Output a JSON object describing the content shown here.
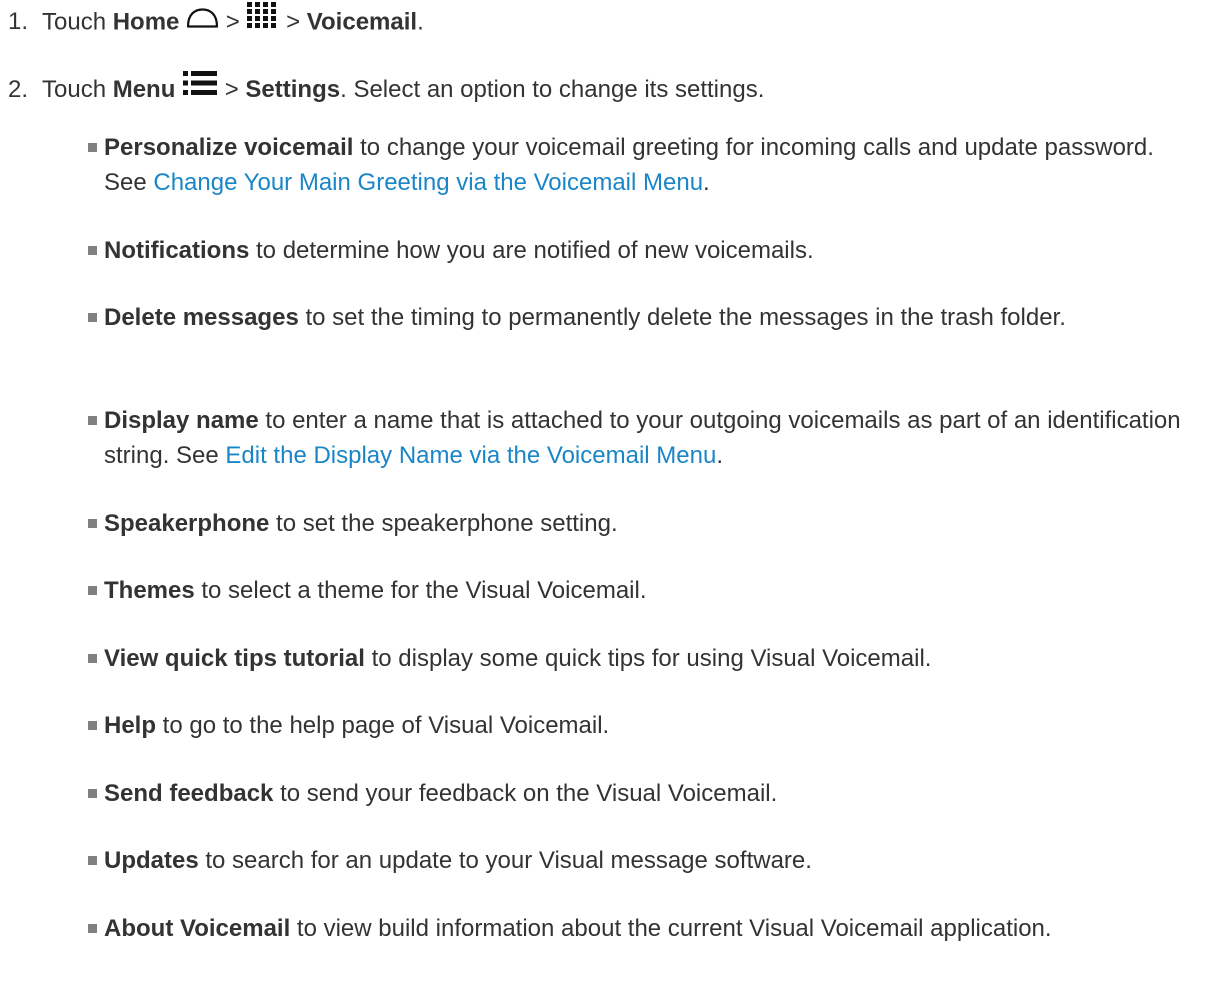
{
  "steps": [
    {
      "number": "1.",
      "touch": "Touch",
      "home": "Home",
      "sep1": ">",
      "sep2": ">",
      "voicemail": "Voicemail",
      "end": "."
    },
    {
      "number": "2.",
      "touch": "Touch",
      "menu": "Menu",
      "sep": ">",
      "settings": "Settings",
      "rest": ". Select an option to change its settings."
    }
  ],
  "options": [
    {
      "term": "Personalize voicemail",
      "text": " to change your voicemail greeting for incoming calls and update password. See ",
      "link": "Change Your Main Greeting via the Voicemail Menu",
      "end": "."
    },
    {
      "term": "Notifications",
      "text": " to determine how you are notified of new voicemails."
    },
    {
      "term": "Delete messages",
      "text": " to set the timing to permanently delete the messages in the trash folder."
    },
    {
      "term": "Display name",
      "text": " to enter a name that is attached to your outgoing voicemails as part of an identification string. See ",
      "link": "Edit the Display Name via the Voicemail Menu",
      "end": "."
    },
    {
      "term": "Speakerphone",
      "text": " to set the speakerphone setting."
    },
    {
      "term": "Themes",
      "text": " to select a theme for the Visual Voicemail."
    },
    {
      "term": "View quick tips tutorial",
      "text": " to display some quick tips for using Visual Voicemail."
    },
    {
      "term": "Help",
      "text": " to go to the help page of Visual Voicemail."
    },
    {
      "term": "Send feedback",
      "text": " to send your feedback on the Visual Voicemail."
    },
    {
      "term": "Updates",
      "text": " to search for an update to your Visual message software."
    },
    {
      "term": "About Voicemail",
      "text": " to view build information about the current Visual Voicemail application."
    }
  ],
  "colors": {
    "text": "#333333",
    "link": "#1a86c8",
    "bullet": "#808080"
  },
  "icons": [
    "home-icon",
    "apps-grid-icon",
    "menu-icon"
  ]
}
